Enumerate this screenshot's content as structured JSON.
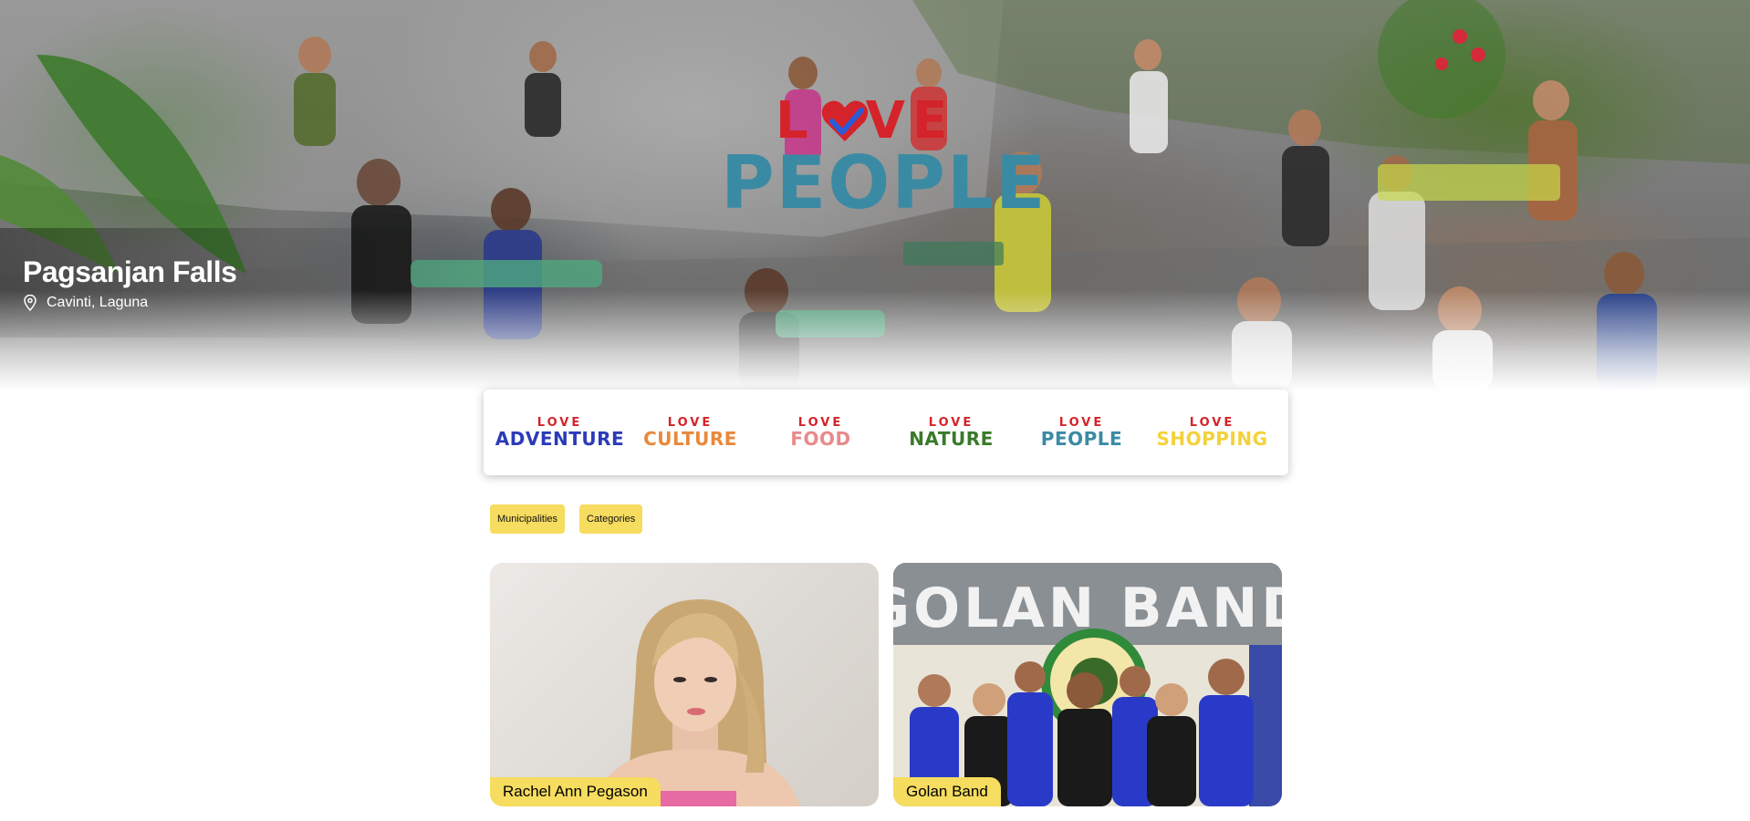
{
  "hero": {
    "place_title": "Pagsanjan Falls",
    "location": "Cavinti, Laguna",
    "logo": {
      "top_word": "LOVE",
      "bottom_word": "PEOPLE"
    },
    "logo_colors": {
      "love": "#d4232a",
      "people": "#3b8aa3"
    }
  },
  "categories": [
    {
      "top": "LOVE",
      "word": "ADVENTURE",
      "color": "#2b3bb8"
    },
    {
      "top": "LOVE",
      "word": "CULTURE",
      "color": "#e8893a"
    },
    {
      "top": "LOVE",
      "word": "FOOD",
      "color": "#e88a8a"
    },
    {
      "top": "LOVE",
      "word": "NATURE",
      "color": "#3a7a2a"
    },
    {
      "top": "LOVE",
      "word": "PEOPLE",
      "color": "#3b8aa3"
    },
    {
      "top": "LOVE",
      "word": "SHOPPING",
      "color": "#f3d23a"
    }
  ],
  "filters": {
    "municipalities": "Municipalities",
    "categories": "Categories"
  },
  "cards": [
    {
      "name": "Rachel Ann Pegason"
    },
    {
      "name": "Golan Band",
      "sign_text": "GOLAN BAND"
    }
  ],
  "colors": {
    "chip": "#f6dc5f",
    "heart": "#d4232a",
    "check": "#2b5bd8"
  }
}
